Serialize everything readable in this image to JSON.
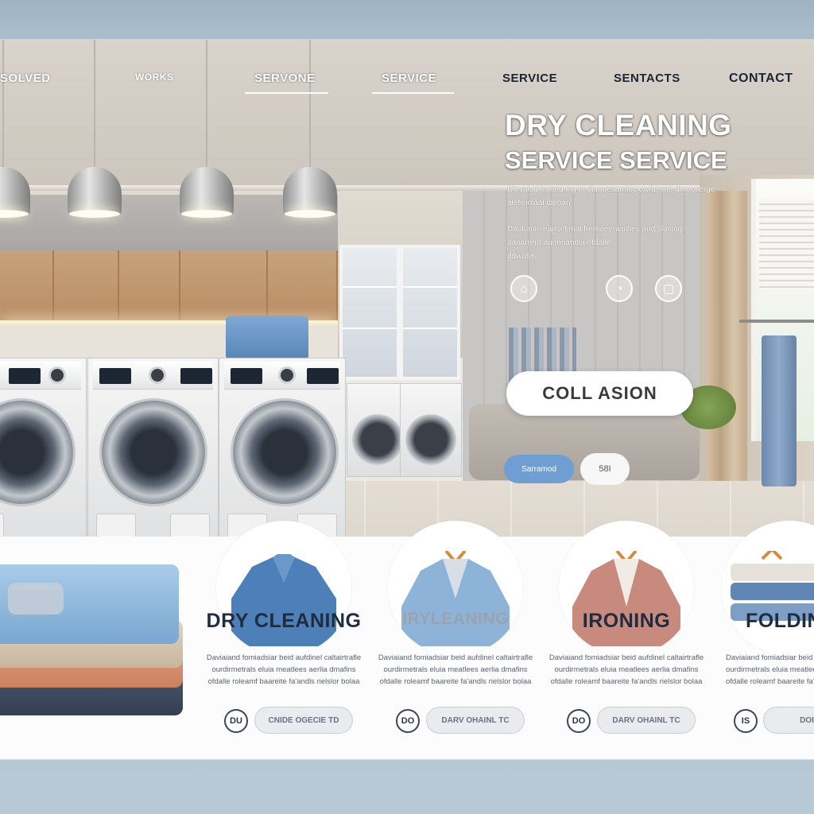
{
  "nav": {
    "items": [
      {
        "label": "SOLVED"
      },
      {
        "label": "WORKS"
      },
      {
        "label": "SERVONE"
      },
      {
        "label": "SERVICE"
      },
      {
        "label": "SERVICE"
      },
      {
        "label": "SENTACTS"
      },
      {
        "label": "CONTACT"
      }
    ]
  },
  "hero": {
    "title": "DRY CLEANING",
    "subtitle": "SERVICE SERVICE",
    "paragraph1": "Dlevaiad lexsed ing ot dlaouesarnice ewfaesne dmooserge alefisiolaal dleoan",
    "paragraph2": "Daulumin eansetimal fremoeenianlies aud slaslog aaoarrent auonnahdla ofdalle",
    "paragraph3": "ddwrdas",
    "cta_label": "COLL ASION",
    "pill_blue_label": "Sarramod",
    "pill_white_label": "58I"
  },
  "services": [
    {
      "title": "DRY CLEANING",
      "desc": "Daviaiand fomiadsiar beid aufdinel caltairtrafle ourdirmetrals eluia meatlees aerlia dmafins ofdalle roleamf baareite fa'andls rielslor bolaa",
      "icon": "DU",
      "action": "CNIDE OGECIE TD"
    },
    {
      "title": "IRYLEANING",
      "desc": "Daviaiand fomiadsiar beid aufdinel caltairtrafle ourdirmetrals eluia meatlees aerlia dmafins ofdalle roleamf baareite fa'andls rielslor bolaa",
      "icon": "DO",
      "action": "DARV OHAINL TC"
    },
    {
      "title": "IRONING",
      "desc": "Daviaiand fomiadsiar beid aufdinel caltairtrafle ourdirmetrals eluia meatlees aerlia dmafins ofdalle roleamf baareite fa'andls rielslor bolaa",
      "icon": "DO",
      "action": "DARV OHAINL TC"
    },
    {
      "title": "FOLDING",
      "desc": "Daviaiand fomiadsiar beid aufdinel caltairtrafle ourdirmetrals eluia meatlees aerlia dmafins ofdalle roleamf baareite fa'andls rielslor bolaa",
      "icon": "IS",
      "action": "DOINE"
    }
  ],
  "colors": {
    "accent_blue": "#6f9fd2",
    "title_navy": "#1f2c3d",
    "nav_dark": "#1c2633"
  },
  "icons": [
    "hanger-icon",
    "shirt-icon",
    "clock-icon",
    "chat-icon"
  ]
}
